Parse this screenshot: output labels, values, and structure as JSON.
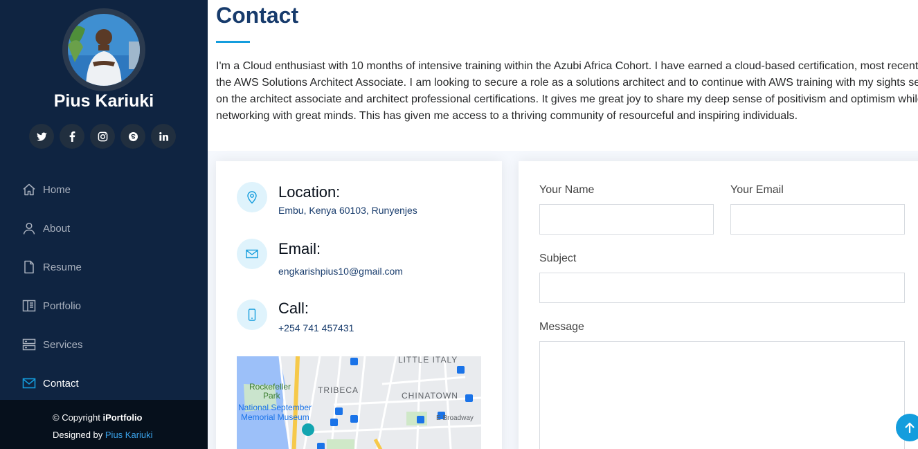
{
  "sidebar": {
    "name": "Pius Kariuki",
    "social": [
      {
        "icon": "twitter-icon"
      },
      {
        "icon": "facebook-icon"
      },
      {
        "icon": "instagram-icon"
      },
      {
        "icon": "skype-icon"
      },
      {
        "icon": "linkedin-icon"
      }
    ],
    "nav": [
      {
        "label": "Home",
        "icon": "home-icon",
        "active": false
      },
      {
        "label": "About",
        "icon": "person-icon",
        "active": false
      },
      {
        "label": "Resume",
        "icon": "file-icon",
        "active": false
      },
      {
        "label": "Portfolio",
        "icon": "book-icon",
        "active": false
      },
      {
        "label": "Services",
        "icon": "server-icon",
        "active": false
      },
      {
        "label": "Contact",
        "icon": "envelope-icon",
        "active": true
      }
    ],
    "footer": {
      "copyright_prefix": "© Copyright ",
      "brand": "iPortfolio",
      "designed_prefix": "Designed by ",
      "designer": "Pius Kariuki"
    }
  },
  "contact": {
    "title": "Contact",
    "intro": "I'm a Cloud enthusiast with 10 months of intensive training within the Azubi Africa Cohort. I have earned a cloud-based certification, most recently the AWS Solutions Architect Associate. I am looking to secure a role as a solutions architect and to continue with AWS training with my sights set on the architect associate and architect professional certifications. It gives me great joy to share my deep sense of positivism and optimism while networking with great minds. This has given me access to a thriving community of resourceful and inspiring individuals.",
    "info": {
      "location_label": "Location:",
      "location_value": "Embu, Kenya 60103, Runyenjes",
      "email_label": "Email:",
      "email_value": "engkarishpius10@gmail.com",
      "call_label": "Call:",
      "call_value": "+254 741 457431"
    },
    "map": {
      "labels": [
        "LITTLE ITALY",
        "TRIBECA",
        "CHINATOWN",
        "Rockefeller",
        "Park",
        "National September",
        "Memorial Museum",
        "E Broadway"
      ]
    },
    "form": {
      "name_label": "Your Name",
      "email_label": "Your Email",
      "subject_label": "Subject",
      "message_label": "Message",
      "name_value": "",
      "email_value": "",
      "subject_value": "",
      "message_value": ""
    }
  },
  "colors": {
    "sidebar_bg": "#0f2441",
    "accent": "#149ddd",
    "title": "#173b6c"
  }
}
